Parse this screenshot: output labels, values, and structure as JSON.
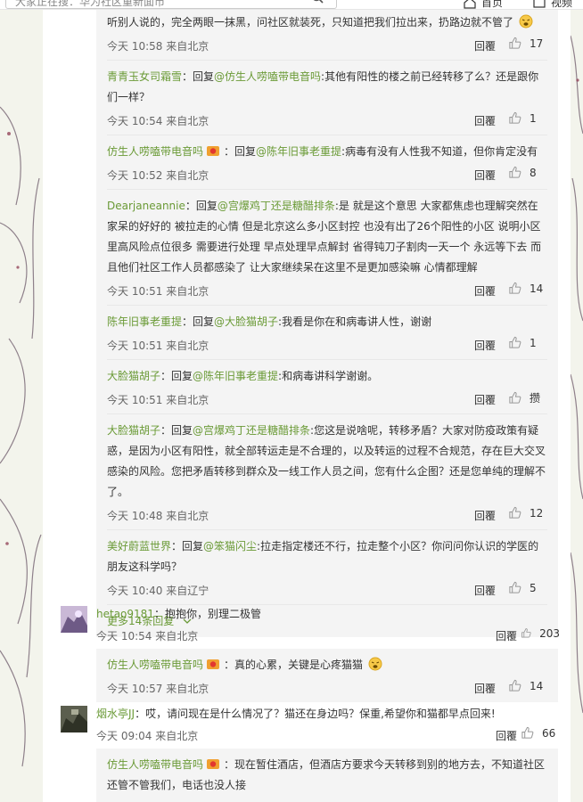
{
  "header": {
    "search_placeholder": "大家正在搜：华为社区重新面市",
    "nav_home": "首页",
    "nav_video": "视频"
  },
  "labels": {
    "reply": "回覆"
  },
  "colors": {
    "user": "#6a9a36",
    "like_icon": "#999999"
  },
  "replies": [
    {
      "user": "",
      "emoji_badge": false,
      "text": "听别人说的，完全两眼一抹黑，问社区就装死，只知道把我们拉出来，扔路边就不管了",
      "trailing_emoji": "tired-face-icon",
      "time": "今天 10:58 来自北京",
      "likes": "17"
    },
    {
      "user": "青青玉女司霜雪",
      "emoji_badge": false,
      "prefix": "：回复",
      "at": "@仿生人唠嗑带电音吗",
      "text": ":其他有阳性的楼之前已经转移了么？还是跟你们一样？",
      "time": "今天 10:54 来自北京",
      "likes": "1"
    },
    {
      "user": "仿生人唠嗑带电音吗",
      "emoji_badge": true,
      "prefix": "：回复",
      "at": "@陈年旧事老重提",
      "text": ":病毒有没有人性我不知道，但你肯定没有",
      "time": "今天 10:52 来自北京",
      "likes": "8"
    },
    {
      "user": "Dearjaneannie",
      "emoji_badge": false,
      "prefix": "：回复",
      "at": "@宫爆鸡丁还是糖醋排条",
      "text": ":是 就是这个意思 大家都焦虑也理解突然在家呆的好好的 被拉走的心情 但是北京这么多小区封控 也没有出了26个阳性的小区 说明小区里高风险点位很多 需要进行处理 早点处理早点解封 省得钝刀子割肉一天一个 永远等下去 而且他们社区工作人员都感染了 让大家继续呆在这里不是更加感染嘛 心情都理解",
      "time": "今天 10:51 来自北京",
      "likes": "14"
    },
    {
      "user": "陈年旧事老重提",
      "emoji_badge": false,
      "prefix": "：回复",
      "at": "@大脸猫胡子",
      "text": ":我看是你在和病毒讲人性，谢谢",
      "time": "今天 10:51 来自北京",
      "likes": "1"
    },
    {
      "user": "大脸猫胡子",
      "emoji_badge": false,
      "prefix": "：回复",
      "at": "@陈年旧事老重提",
      "text": ":和病毒讲科学谢谢。",
      "time": "今天 10:51 来自北京",
      "likes": "攒"
    },
    {
      "user": "大脸猫胡子",
      "emoji_badge": false,
      "prefix": "：回复",
      "at": "@宫爆鸡丁还是糖醋排条",
      "text": ":您这是说啥呢，转移矛盾？大家对防疫政策有疑惑，是因为小区有阳性，就全部转运走是不合理的，以及转运的过程不合规范，存在巨大交叉感染的风险。您把矛盾转移到群众及一线工作人员之间，您有什么企图？还是您单纯的理解不了。",
      "time": "今天 10:48 来自北京",
      "likes": "12"
    },
    {
      "user": "美好蔚蓝世界",
      "emoji_badge": false,
      "prefix": "：回复",
      "at": "@笨猫闪尘",
      "text": ":拉走指定楼还不行，拉走整个小区？你问问你认识的学医的朋友这科学吗？",
      "time": "今天 10:40 来自辽宁",
      "likes": "5"
    }
  ],
  "more_replies": "更多14条回复",
  "comments": [
    {
      "user": "hetao9181",
      "text": "：抱抱你，别理二极管",
      "time": "今天 10:54 来自北京",
      "likes": "203",
      "reply": {
        "user": "仿生人唠嗑带电音吗",
        "text": "：真的心累，关键是心疼猫猫",
        "trailing_emoji": "tired-face-icon",
        "time": "今天 10:57 来自北京",
        "likes": "14"
      }
    },
    {
      "user": "烟水亭JJ",
      "text": "：哎，请问现在是什么情况了？猫还在身边吗？保重,希望你和猫都早点回来!",
      "time": "今天 09:04 来自北京",
      "likes": "66",
      "reply": {
        "user": "仿生人唠嗑带电音吗",
        "text": "：现在暂住酒店，但酒店方要求今天转移到别的地方去，不知道社区还管不管我们，电话也没人接"
      }
    }
  ]
}
